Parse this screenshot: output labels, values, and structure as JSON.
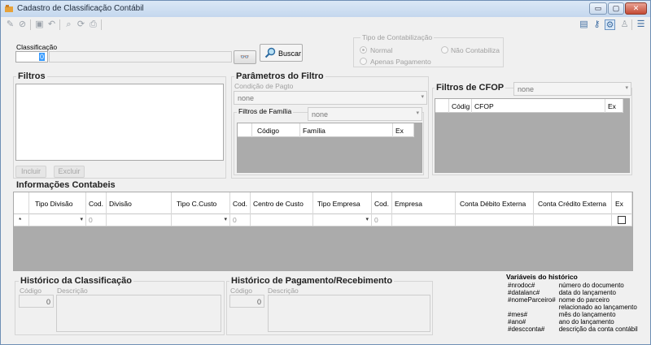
{
  "window": {
    "title": "Cadastro de Classificação Contábil",
    "buttons": {
      "minimize": "▭",
      "maximize": "▢",
      "close": "✕"
    }
  },
  "toolbar": {
    "left_icons": [
      "new-icon",
      "cancel-icon",
      "save-icon",
      "undo-icon",
      "find-icon",
      "refresh-icon",
      "print-icon"
    ],
    "right_icons": [
      "report-icon",
      "key-icon",
      "config-icon",
      "user-icon",
      "list-icon"
    ]
  },
  "classificacao": {
    "label": "Classificação",
    "value": "0",
    "search_label": "Buscar"
  },
  "tipo_contabilizacao": {
    "legend": "Tipo de Contabilização",
    "options": [
      "Normal",
      "Não Contabiliza",
      "Apenas Pagamento"
    ]
  },
  "filtros": {
    "title": "Filtros",
    "incluir": "Incluir",
    "excluir": "Excluir"
  },
  "parametros": {
    "title": "Parâmetros do Filtro",
    "condicao_label": "Condição de Pagto",
    "condicao_value": "none",
    "familia_label": "Filtros de Família",
    "familia_value": "none",
    "grid_headers": [
      "Código",
      "Família",
      "Ex"
    ]
  },
  "cfop": {
    "title": "Filtros de CFOP",
    "value": "none",
    "grid_headers": [
      "Códig",
      "CFOP",
      "Ex"
    ]
  },
  "informacoes": {
    "title": "Informações Contabeis",
    "headers": [
      "Tipo Divisão",
      "Cod.",
      "Divisão",
      "Tipo C.Custo",
      "Cod.",
      "Centro de Custo",
      "Tipo Empresa",
      "Cod.",
      "Empresa",
      "Conta Débito Externa",
      "Conta Crédito Externa",
      "Ex"
    ],
    "new_row_marker": "*",
    "row_values": [
      "0",
      "0",
      "0"
    ]
  },
  "historico_classificacao": {
    "title": "Histórico da Classificação",
    "codigo_label": "Código",
    "descricao_label": "Descrição",
    "codigo_value": "0"
  },
  "historico_pagamento": {
    "title": "Histórico de Pagamento/Recebimento",
    "codigo_label": "Código",
    "descricao_label": "Descrição",
    "codigo_value": "0"
  },
  "variaveis": {
    "title": "Variáveis do histórico",
    "items": [
      {
        "key": "#nrodoc#",
        "desc": "número do documento"
      },
      {
        "key": "#datalanc#",
        "desc": "data do lançamento"
      },
      {
        "key": "#nomeParceiro#",
        "desc": "nome do parceiro"
      },
      {
        "key": "",
        "desc": "relacionado ao lançamento"
      },
      {
        "key": "#mes#",
        "desc": "mês do lançamento"
      },
      {
        "key": "#ano#",
        "desc": "ano do lançamento"
      },
      {
        "key": "#descconta#",
        "desc": "descrição da conta contábil"
      }
    ]
  }
}
